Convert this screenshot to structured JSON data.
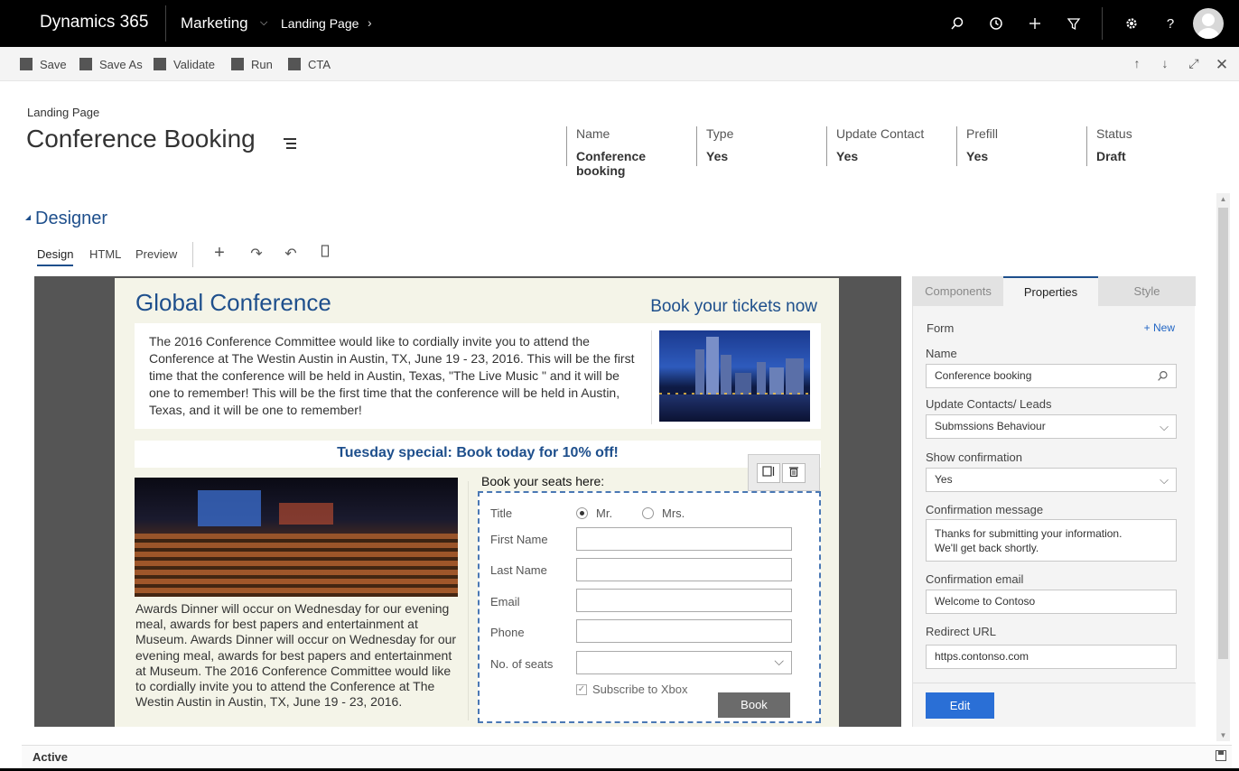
{
  "topnav": {
    "brand": "Dynamics 365",
    "module": "Marketing",
    "crumb": "Landing Page",
    "icons": [
      "search-icon",
      "history-icon",
      "plus-icon",
      "filter-icon",
      "settings-icon",
      "help-icon"
    ]
  },
  "commandbar": {
    "save": "Save",
    "save_as": "Save As",
    "validate": "Validate",
    "run": "Run",
    "cta": "CTA"
  },
  "header": {
    "entity_type": "Landing Page",
    "title": "Conference Booking",
    "fields": [
      {
        "label": "Name",
        "value": "Conference booking"
      },
      {
        "label": "Type",
        "value": "Yes"
      },
      {
        "label": "Update Contact",
        "value": "Yes"
      },
      {
        "label": "Prefill",
        "value": "Yes"
      },
      {
        "label": "Status",
        "value": "Draft"
      }
    ]
  },
  "designer": {
    "title": "Designer",
    "tabs": [
      "Design",
      "HTML",
      "Preview"
    ]
  },
  "page": {
    "title": "Global Conference",
    "book_link": "Book your tickets now",
    "intro": "The 2016 Conference Committee would like to cordially invite you to attend the Conference at The Westin Austin in Austin, TX, June 19 - 23, 2016. This will be the first time that the conference will be held in Austin, Texas, \"The Live Music \" and it will be one to remember! This will be the first time that the conference will be held in Austin, Texas, and it will be one to remember!",
    "special": "Tuesday special: Book today for 10% off!",
    "awards": "Awards Dinner will occur on Wednesday for our evening meal, awards for best papers and entertainment at Museum. Awards Dinner will occur on Wednesday for our evening meal, awards for best papers and entertainment at Museum. The 2016 Conference Committee would like to cordially invite you to attend the Conference at The Westin Austin in Austin, TX, June 19 - 23, 2016.",
    "seats_title": "Book  your seats here:",
    "form": {
      "title_label": "Title",
      "title_options": [
        "Mr.",
        "Mrs."
      ],
      "title_selected": "Mr.",
      "first_name": "First Name",
      "last_name": "Last Name",
      "email": "Email",
      "phone": "Phone",
      "seats": "No. of seats",
      "subscribe": "Subscribe to Xbox",
      "book": "Book"
    }
  },
  "properties": {
    "tabs": [
      "Components",
      "Properties",
      "Style"
    ],
    "active_tab": "Properties",
    "section": "Form",
    "new": "+ New",
    "name_label": "Name",
    "name_value": "Conference booking",
    "update_label": "Update Contacts/ Leads",
    "update_value": "Submssions Behaviour",
    "confirm_label": "Show confirmation",
    "confirm_value": "Yes",
    "message_label": "Confirmation message",
    "message_line1": "Thanks for submitting your information.",
    "message_line2": "We'll get back shortly.",
    "email_label": "Confirmation email",
    "email_value": "Welcome to Contoso",
    "redirect_label": "Redirect URL",
    "redirect_value": "https.contonso.com",
    "edit": "Edit"
  },
  "status": "Active",
  "colors": {
    "accent": "#1e4f8c",
    "button": "#2a6fd6"
  }
}
